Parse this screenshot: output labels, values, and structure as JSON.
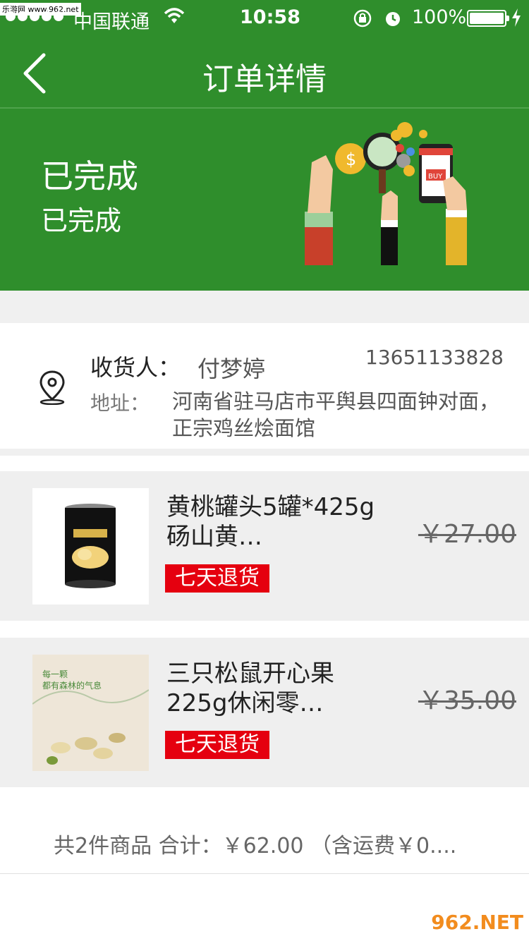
{
  "status_bar": {
    "watermark": "乐游网 www.962.net",
    "carrier": "中国联通",
    "time": "10:58",
    "battery": "100%"
  },
  "nav": {
    "title": "订单详情",
    "back_icon": "chevron-left-icon"
  },
  "order_status": {
    "main": "已完成",
    "sub": "已完成"
  },
  "address": {
    "receiver_label": "收货人：",
    "receiver_name": "付梦婷",
    "phone": "13651133828",
    "address_label": "地址：",
    "address_value": "河南省驻马店市平舆县四面钟对面，正宗鸡丝烩面馆"
  },
  "products": [
    {
      "name": "黄桃罐头5罐*425g 砀山黄…",
      "tag": "七天退货",
      "price": "￥27.00"
    },
    {
      "name": "三只松鼠开心果225g休闲零…",
      "tag": "七天退货",
      "price": "￥35.00",
      "image_text_1": "每一颗",
      "image_text_2": "都有森林的气息"
    }
  ],
  "summary": "共2件商品 合计：￥62.00 （含运费￥0....",
  "watermark_bottom": "962.NET",
  "colors": {
    "brand_green": "#2f8e2c",
    "tag_red": "#e5000f"
  }
}
